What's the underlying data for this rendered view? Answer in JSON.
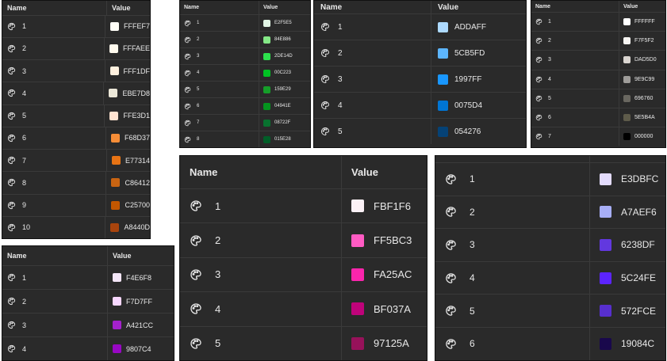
{
  "panels": [
    {
      "headers": {
        "name": "Name",
        "value": "Value"
      },
      "rows": [
        {
          "label": "1",
          "hex": "FFFEF7",
          "color": "#FFFEF7"
        },
        {
          "label": "2",
          "hex": "FFFAEE",
          "color": "#FFFAEE"
        },
        {
          "label": "3",
          "hex": "FFF1DF",
          "color": "#FFF1DF"
        },
        {
          "label": "4",
          "hex": "EBE7D8",
          "color": "#EBE7D8"
        },
        {
          "label": "5",
          "hex": "FFE3D1",
          "color": "#FFE3D1"
        },
        {
          "label": "6",
          "hex": "F68D37",
          "color": "#F68D37"
        },
        {
          "label": "7",
          "hex": "E77314",
          "color": "#E77314"
        },
        {
          "label": "8",
          "hex": "C86412",
          "color": "#C86412"
        },
        {
          "label": "9",
          "hex": "C25700",
          "color": "#C25700"
        },
        {
          "label": "10",
          "hex": "A8440D",
          "color": "#A8440D"
        }
      ]
    },
    {
      "headers": {
        "name": "Name",
        "value": "Value"
      },
      "rows": [
        {
          "label": "1",
          "hex": "E2F5E5",
          "color": "#E2F5E5"
        },
        {
          "label": "2",
          "hex": "84E886",
          "color": "#84E886"
        },
        {
          "label": "3",
          "hex": "2DE14D",
          "color": "#2DE14D"
        },
        {
          "label": "4",
          "hex": "00C223",
          "color": "#00C223"
        },
        {
          "label": "5",
          "hex": "159E29",
          "color": "#159E29"
        },
        {
          "label": "6",
          "hex": "04941E",
          "color": "#04941E"
        },
        {
          "label": "7",
          "hex": "08722F",
          "color": "#08722F"
        },
        {
          "label": "8",
          "hex": "015E28",
          "color": "#015E28"
        }
      ]
    },
    {
      "headers": {
        "name": "Name",
        "value": "Value"
      },
      "rows": [
        {
          "label": "1",
          "hex": "ADDAFF",
          "color": "#ADDAFF"
        },
        {
          "label": "2",
          "hex": "5CB5FD",
          "color": "#5CB5FD"
        },
        {
          "label": "3",
          "hex": "1997FF",
          "color": "#1997FF"
        },
        {
          "label": "4",
          "hex": "0075D4",
          "color": "#0075D4"
        },
        {
          "label": "5",
          "hex": "054276",
          "color": "#054276"
        }
      ]
    },
    {
      "headers": {
        "name": "Name",
        "value": "Value"
      },
      "rows": [
        {
          "label": "1",
          "hex": "FFFFFF",
          "color": "#FFFFFF"
        },
        {
          "label": "2",
          "hex": "F7F5F2",
          "color": "#F7F5F2"
        },
        {
          "label": "3",
          "hex": "DAD5D0",
          "color": "#DAD5D0"
        },
        {
          "label": "4",
          "hex": "9E9C99",
          "color": "#9E9C99"
        },
        {
          "label": "5",
          "hex": "696760",
          "color": "#696760"
        },
        {
          "label": "6",
          "hex": "5E5B4A",
          "color": "#5E5B4A"
        },
        {
          "label": "7",
          "hex": "000000",
          "color": "#000000"
        }
      ]
    },
    {
      "headers": {
        "name": "Name",
        "value": "Value"
      },
      "rows": [
        {
          "label": "1",
          "hex": "F4E6F8",
          "color": "#F4E6F8"
        },
        {
          "label": "2",
          "hex": "F7D7FF",
          "color": "#F7D7FF"
        },
        {
          "label": "3",
          "hex": "A421CC",
          "color": "#A421CC"
        },
        {
          "label": "4",
          "hex": "9807C4",
          "color": "#9807C4"
        }
      ]
    },
    {
      "headers": {
        "name": "Name",
        "value": "Value"
      },
      "rows": [
        {
          "label": "1",
          "hex": "FBF1F6",
          "color": "#FBF1F6"
        },
        {
          "label": "2",
          "hex": "FF5BC3",
          "color": "#FF5BC3"
        },
        {
          "label": "3",
          "hex": "FA25AC",
          "color": "#FA25AC"
        },
        {
          "label": "4",
          "hex": "BF037A",
          "color": "#BF037A"
        },
        {
          "label": "5",
          "hex": "97125A",
          "color": "#97125A"
        }
      ]
    },
    {
      "headers": {
        "name": "",
        "value": ""
      },
      "rows": [
        {
          "label": "1",
          "hex": "E3DBFC",
          "color": "#E3DBFC"
        },
        {
          "label": "2",
          "hex": "A7AEF6",
          "color": "#A7AEF6"
        },
        {
          "label": "3",
          "hex": "6238DF",
          "color": "#6238DF"
        },
        {
          "label": "4",
          "hex": "5C24FE",
          "color": "#5C24FE"
        },
        {
          "label": "5",
          "hex": "572FCE",
          "color": "#572FCE"
        },
        {
          "label": "6",
          "hex": "19084C",
          "color": "#19084C"
        }
      ]
    }
  ],
  "icons": {
    "row_icon": "palette-icon"
  }
}
